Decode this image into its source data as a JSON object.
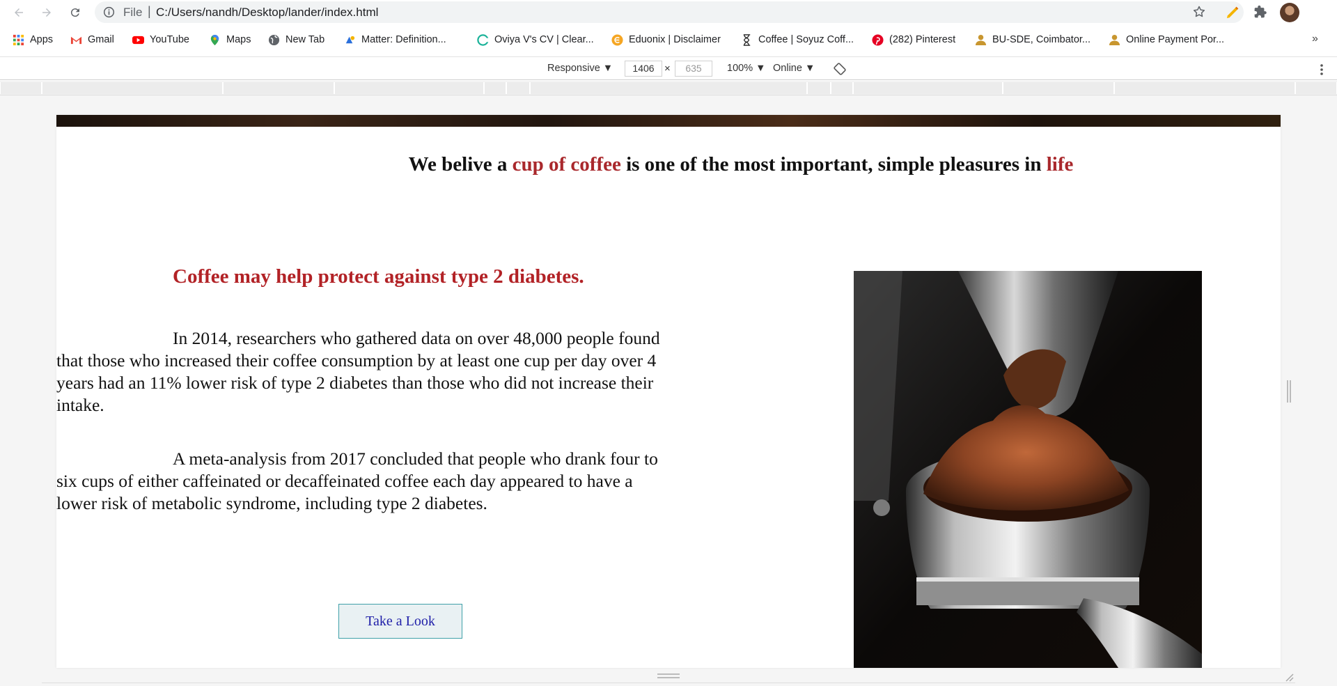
{
  "browser": {
    "file_label": "File",
    "url": "C:/Users/nandh/Desktop/lander/index.html"
  },
  "bookmarks": [
    {
      "label": "Apps",
      "icon": "apps-grid-icon"
    },
    {
      "label": "Gmail",
      "icon": "gmail-icon"
    },
    {
      "label": "YouTube",
      "icon": "youtube-icon"
    },
    {
      "label": "Maps",
      "icon": "maps-icon"
    },
    {
      "label": "New Tab",
      "icon": "globe-icon"
    },
    {
      "label": "Matter: Definition...",
      "icon": "matter-icon"
    },
    {
      "label": "Oviya V's CV | Clear...",
      "icon": "clear-icon"
    },
    {
      "label": "Eduonix | Disclaimer",
      "icon": "eduonix-icon"
    },
    {
      "label": "Coffee | Soyuz Coff...",
      "icon": "hourglass-icon"
    },
    {
      "label": "(282) Pinterest",
      "icon": "pinterest-icon"
    },
    {
      "label": "BU-SDE, Coimbator...",
      "icon": "person-icon"
    },
    {
      "label": "Online Payment Por...",
      "icon": "person-icon"
    }
  ],
  "device_toolbar": {
    "mode": "Responsive",
    "width": "1406",
    "height": "635",
    "zoom": "100%",
    "throttle": "Online"
  },
  "page": {
    "tagline_pre": "We belive a ",
    "tagline_accent1": "cup of coffee",
    "tagline_mid": " is one of the most important, simple pleasures in ",
    "tagline_accent2": "life",
    "heading": "Coffee may help protect against type 2 diabetes.",
    "paragraph1": "In 2014, researchers who gathered data on over 48,000 people found that those who increased their coffee consumption by at least one cup per day over 4 years had an 11% lower risk of type 2 diabetes than those who did not increase their intake.",
    "paragraph2": "A meta-analysis from 2017 concluded that people who drank four to six cups of either caffeinated or decaffeinated coffee each day appeared to have a lower risk of metabolic syndrome, including type 2 diabetes.",
    "cta_label": "Take a Look"
  },
  "colors": {
    "accent": "#a9282c",
    "heading": "#b22226",
    "cta_text": "#1e1ea8",
    "cta_border": "#3fa0a8"
  }
}
